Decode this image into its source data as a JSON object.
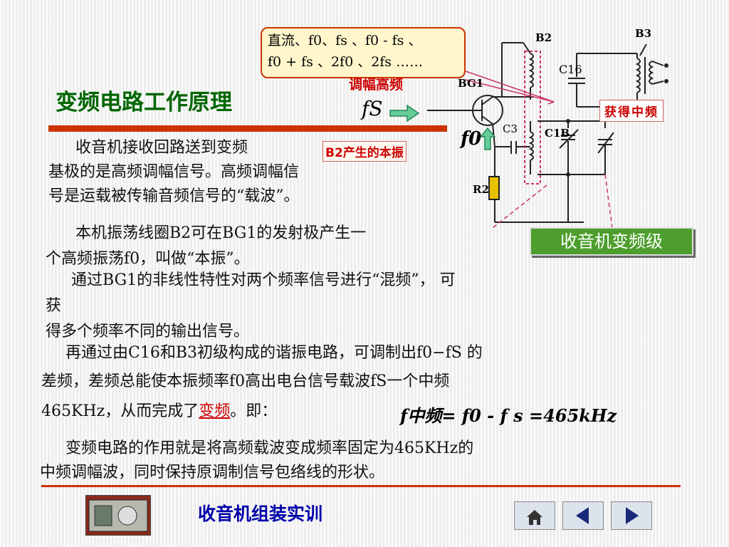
{
  "title": "变频电路工作原理",
  "formula_box": {
    "line1": "直流、f0、fs 、f0 - fs 、",
    "line2": "f0 + fs 、2f0 、2fs ……"
  },
  "mod_label": "调幅高频",
  "fs_label": "fS",
  "f0_label": "f0",
  "tag_b2": "B2产生的本振",
  "tag_if": "获得中频",
  "stage_button": "收音机变频级",
  "labels": {
    "bg1": "BG1",
    "b2": "B2",
    "b3": "B3",
    "c16": "C16",
    "c3": "C3",
    "c1b": "C1B",
    "r2": "R2"
  },
  "paragraphs": {
    "p1_l1": "收音机接收回路送到变频",
    "p1_l2": "基极的是高频调幅信号。高频调幅信",
    "p1_l3": "号是运载被传输音频信号的“载波”。",
    "p2_l1": "本机振荡线圈B2可在BG1的发射极产生一",
    "p2_l2": "个高频振荡f0，叫做“本振”。",
    "p3_l1": "通过BG1的非线性特性对两个频率信号进行“混频”， 可",
    "p3_l2": "获",
    "p3_l3": "得多个频率不同的输出信号。",
    "p4_l1": "再通过由C16和B3初级构成的谐振电路，可调制出f0−fS 的",
    "p4_l2": "差频，差频总能使本振频率f0高出电台信号载波fS一个中频",
    "p4_l3a": "465KHz，从而完成了",
    "p4_l3b": "变频",
    "p4_l3c": "。即：",
    "formula": "f中频= f0 - f s =465kHz",
    "p5_l1": "变频电路的作用就是将高频载波变成频率固定为465KHz的",
    "p5_l2": "中频调幅波，同时保持原调制信号包络线的形状。"
  },
  "footer": "收音机组装实训",
  "nav": [
    "home-icon",
    "prev-arrow-icon",
    "next-arrow-icon"
  ],
  "colors": {
    "title": "#006600",
    "accent": "#cc3300",
    "highlight": "#cc0000",
    "button": "#4d9e2c",
    "footer": "#0000aa"
  }
}
